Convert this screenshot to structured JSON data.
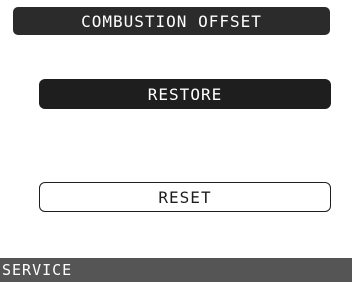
{
  "header": {
    "title": "COMBUSTION OFFSET"
  },
  "actions": {
    "restore_label": "RESTORE",
    "reset_label": "RESET"
  },
  "status_bar": {
    "label": "SERVICE"
  },
  "colors": {
    "title_bg": "#2b2b2b",
    "primary_button_bg": "#1e1e1e",
    "status_bar_bg": "#555555",
    "background": "#ffffff"
  }
}
